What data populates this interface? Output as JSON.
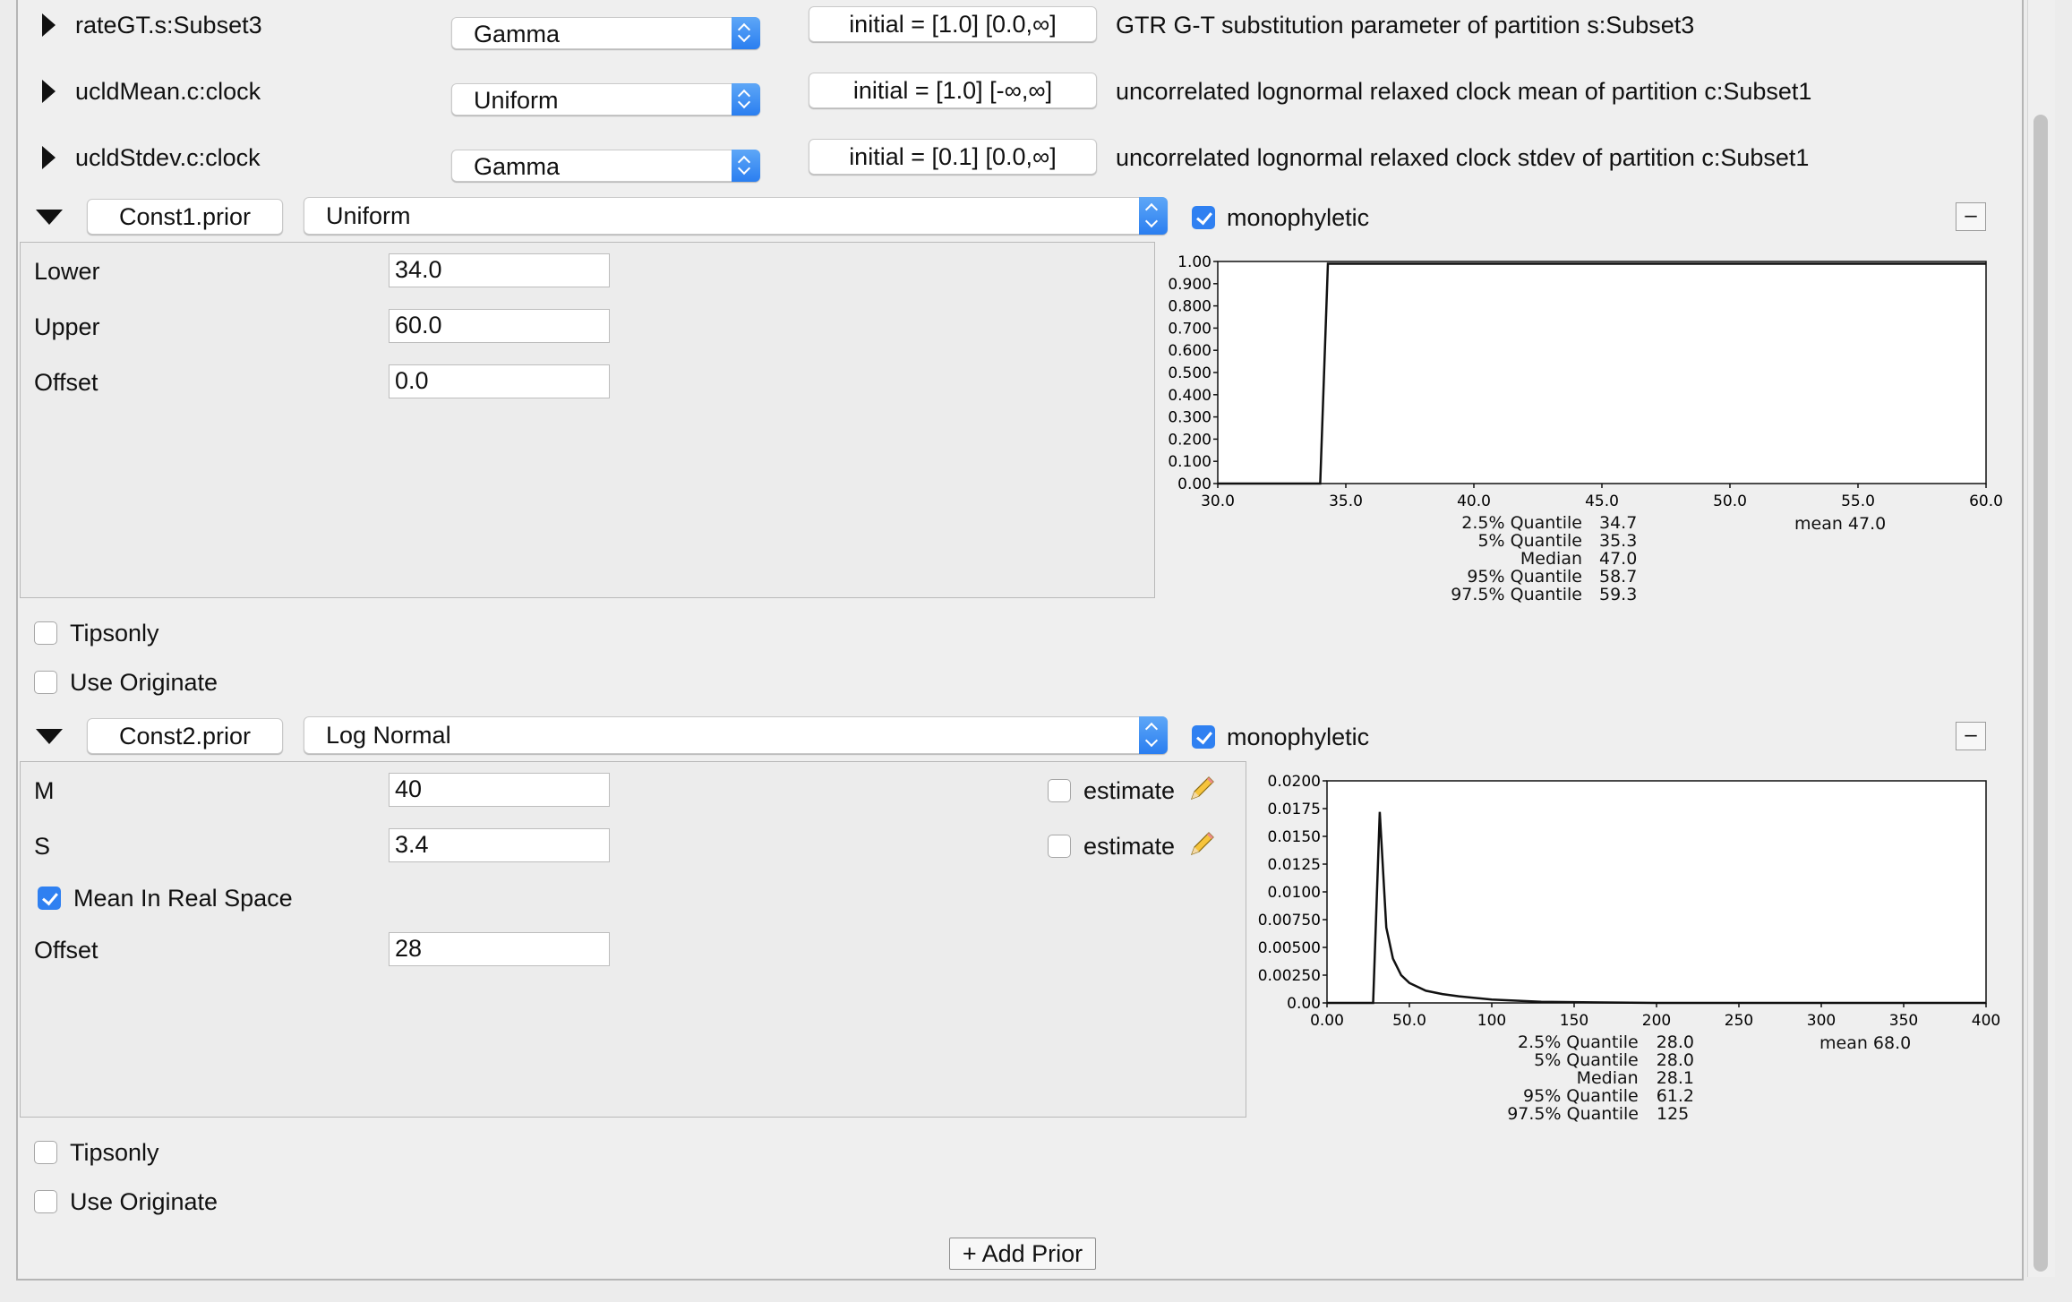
{
  "params": [
    {
      "name": "rateGT.s:Subset3",
      "dist": "Gamma",
      "initial": "initial = [1.0] [0.0,∞]",
      "desc": "GTR G-T substitution parameter of partition s:Subset3"
    },
    {
      "name": "ucldMean.c:clock",
      "dist": "Uniform",
      "initial": "initial = [1.0] [-∞,∞]",
      "desc": "uncorrelated lognormal relaxed clock mean of partition c:Subset1"
    },
    {
      "name": "ucldStdev.c:clock",
      "dist": "Gamma",
      "initial": "initial = [0.1] [0.0,∞]",
      "desc": "uncorrelated lognormal relaxed clock stdev of partition c:Subset1"
    }
  ],
  "prior1": {
    "name": "Const1.prior",
    "dist": "Uniform",
    "monophyletic_label": "monophyletic",
    "monophyletic": true,
    "minus": "–",
    "fields": [
      {
        "label": "Lower",
        "value": "34.0"
      },
      {
        "label": "Upper",
        "value": "60.0"
      },
      {
        "label": "Offset",
        "value": "0.0"
      }
    ],
    "tipsonly": "Tipsonly",
    "use_originate": "Use Originate",
    "stats": {
      "q025_label": "2.5% Quantile",
      "q025": "34.7",
      "q05_label": "5% Quantile",
      "q05": "35.3",
      "median_label": "Median",
      "median": "47.0",
      "q95_label": "95% Quantile",
      "q95": "58.7",
      "q975_label": "97.5% Quantile",
      "q975": "59.3",
      "mean": "mean 47.0"
    }
  },
  "prior2": {
    "name": "Const2.prior",
    "dist": "Log Normal",
    "monophyletic_label": "monophyletic",
    "monophyletic": true,
    "minus": "–",
    "M_label": "M",
    "M": "40",
    "S_label": "S",
    "S": "3.4",
    "estimate_label": "estimate",
    "mean_real_space": "Mean In Real Space",
    "mean_real_space_checked": true,
    "offset_label": "Offset",
    "offset": "28",
    "tipsonly": "Tipsonly",
    "use_originate": "Use Originate",
    "stats": {
      "q025_label": "2.5% Quantile",
      "q025": "28.0",
      "q05_label": "5% Quantile",
      "q05": "28.0",
      "median_label": "Median",
      "median": "28.1",
      "q95_label": "95% Quantile",
      "q95": "61.2",
      "q975_label": "97.5% Quantile",
      "q975": "125",
      "mean": "mean 68.0"
    }
  },
  "add_prior": "+ Add Prior",
  "chart_data": [
    {
      "type": "line",
      "title": "",
      "xlabel": "",
      "ylabel": "",
      "x_ticks": [
        "30.0",
        "35.0",
        "40.0",
        "45.0",
        "50.0",
        "55.0",
        "60.0"
      ],
      "y_ticks": [
        "0.00",
        "0.100",
        "0.200",
        "0.300",
        "0.400",
        "0.500",
        "0.600",
        "0.700",
        "0.800",
        "0.900",
        "1.00"
      ],
      "xlim": [
        30,
        60
      ],
      "ylim": [
        0,
        1
      ],
      "x": [
        30,
        34,
        34.3,
        60
      ],
      "y": [
        0,
        0,
        0.99,
        0.99
      ]
    },
    {
      "type": "line",
      "title": "",
      "xlabel": "",
      "ylabel": "",
      "x_ticks": [
        "0.00",
        "50.0",
        "100",
        "150",
        "200",
        "250",
        "300",
        "350",
        "400"
      ],
      "y_ticks": [
        "0.00",
        "0.00250",
        "0.00500",
        "0.00750",
        "0.0100",
        "0.0125",
        "0.0150",
        "0.0175",
        "0.0200"
      ],
      "xlim": [
        0,
        400
      ],
      "ylim": [
        0,
        0.02
      ],
      "x": [
        0,
        28,
        32,
        36,
        40,
        45,
        50,
        60,
        70,
        80,
        100,
        130,
        200,
        400
      ],
      "y": [
        0,
        0,
        0.0172,
        0.0068,
        0.004,
        0.0025,
        0.0018,
        0.0011,
        0.0008,
        0.0006,
        0.0003,
        0.0001,
        0,
        0
      ]
    }
  ]
}
